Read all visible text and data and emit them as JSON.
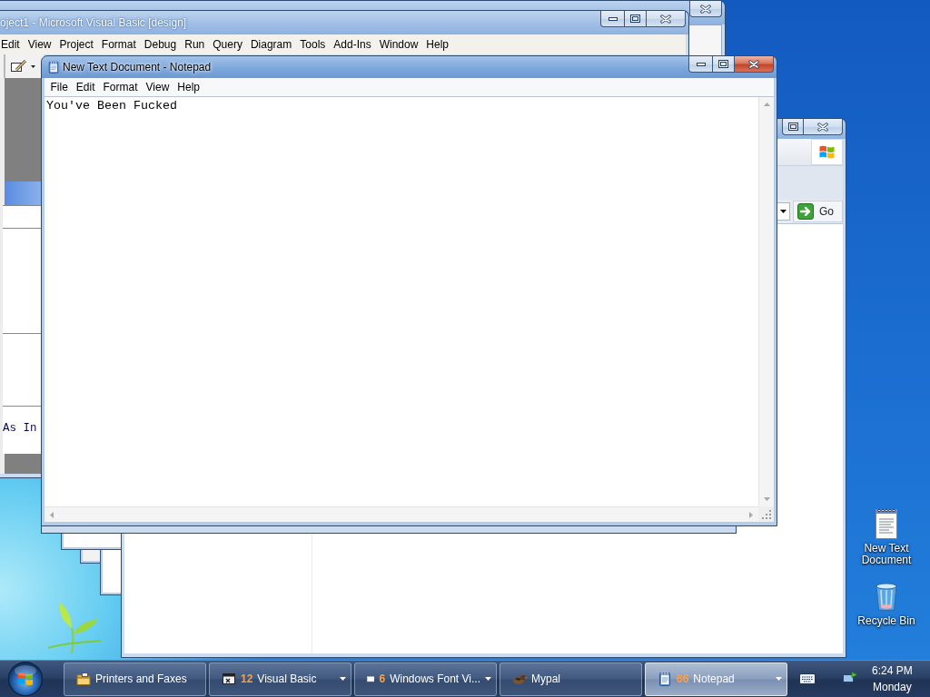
{
  "ide_window": {
    "title": "oject1 - Microsoft Visual Basic [design]",
    "active": false,
    "menu": [
      "Edit",
      "View",
      "Project",
      "Format",
      "Debug",
      "Run",
      "Query",
      "Diagram",
      "Tools",
      "Add-Ins",
      "Window",
      "Help"
    ],
    "code_line": "As In"
  },
  "notepad_window": {
    "title": "New Text Document - Notepad",
    "active": true,
    "menu": [
      "File",
      "Edit",
      "Format",
      "View",
      "Help"
    ],
    "text": "You've Been Fucked"
  },
  "browser_window": {
    "active": false,
    "go_button": "Go"
  },
  "desktop_icons": [
    {
      "kind": "document",
      "label": "New Text Document"
    },
    {
      "kind": "recycle_bin",
      "label": "Recycle Bin"
    }
  ],
  "taskbar": {
    "buttons": [
      {
        "kind": "folder",
        "label": "Printers and Faxes",
        "grouped": false,
        "selected": false
      },
      {
        "kind": "program",
        "count": "12",
        "label": "Visual Basic",
        "grouped": true,
        "selected": false
      },
      {
        "kind": "window",
        "count": "6",
        "label": "Windows Font Vi...",
        "grouped": true,
        "selected": false
      },
      {
        "kind": "bird",
        "label": "Mypal",
        "grouped": false,
        "selected": false
      },
      {
        "kind": "notebook",
        "count": "66",
        "label": "Notepad",
        "grouped": true,
        "selected": true
      }
    ],
    "clock": {
      "time": "6:24 PM",
      "day": "Monday"
    }
  }
}
